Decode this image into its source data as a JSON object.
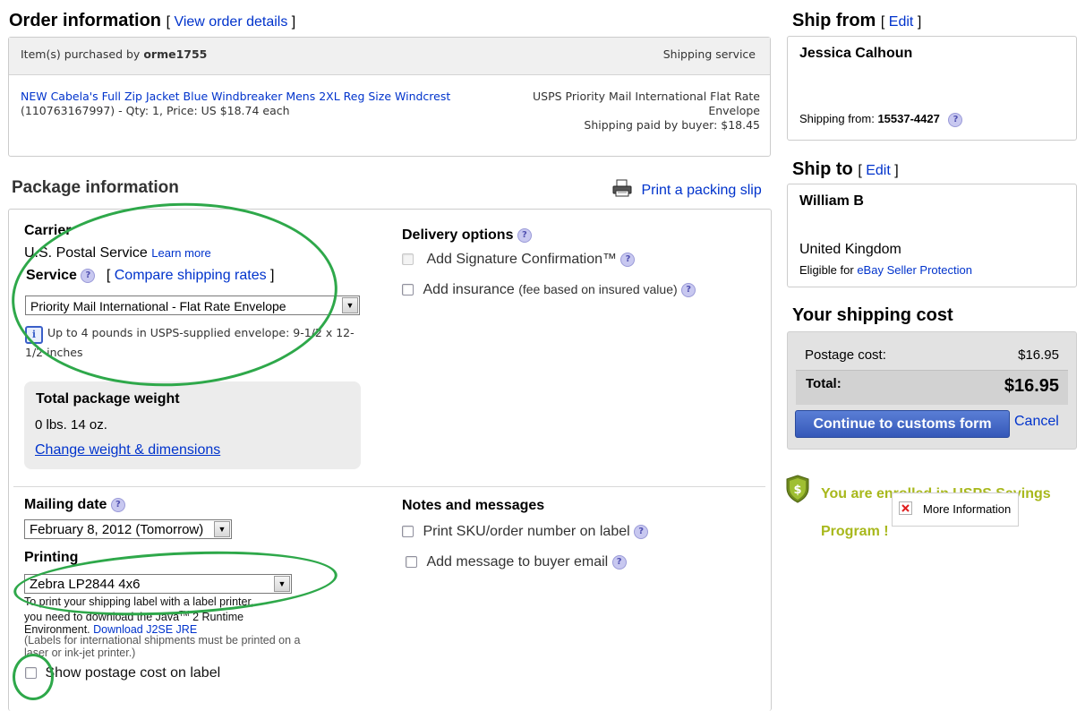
{
  "order": {
    "title": "Order information",
    "view_details_link": "View order details",
    "purchased_by_label": "Item(s) purchased by",
    "buyer": "orme1755",
    "shipping_service_header": "Shipping service",
    "item_title": "NEW Cabela's Full Zip Jacket Blue Windbreaker Mens 2XL Reg Size Windcrest",
    "item_details": "(110763167997) - Qty: 1, Price: US $18.74 each",
    "service_line1": "USPS Priority Mail International Flat Rate",
    "service_line2": "Envelope",
    "shipping_paid": "Shipping paid by buyer: $18.45"
  },
  "package": {
    "title": "Package information",
    "print_slip": "Print a packing slip",
    "carrier_label": "Carrier",
    "carrier_value": "U.S. Postal Service",
    "learn_more": "Learn more",
    "service_label": "Service",
    "compare_rates": "Compare shipping rates",
    "service_selected": "Priority Mail International - Flat Rate Envelope",
    "service_note": "Up to 4 pounds in USPS-supplied envelope: 9-1/2 x 12-1/2 inches",
    "delivery_options_label": "Delivery options",
    "signature_label": "Add Signature Confirmation™",
    "insurance_label": "Add insurance",
    "insurance_note": "(fee based on insured value)",
    "weight_title": "Total package weight",
    "weight_value": "0 lbs. 14 oz.",
    "change_weight": "Change weight & dimensions",
    "mailing_date_label": "Mailing date",
    "mailing_date_selected": "February 8, 2012 (Tomorrow)",
    "printing_label": "Printing",
    "printer_selected": "Zebra LP2844 4x6",
    "printer_note_1": "To print your shipping label with a label printer,",
    "printer_note_2": "you need to download the Java",
    "printer_note_tm": "TM",
    "printer_note_3": " 2 Runtime",
    "printer_note_4": "Environment.",
    "download_link": "Download J2SE JRE",
    "printer_note_5": "(Labels for international shipments must be printed on a",
    "printer_note_6": "laser or ink-jet printer.)",
    "show_postage_label": "Show postage cost on label",
    "notes_label": "Notes and messages",
    "print_sku_label": "Print SKU/order number on label",
    "add_message_label": "Add message to buyer email"
  },
  "ship_from": {
    "title": "Ship from",
    "edit": "Edit",
    "name": "Jessica Calhoun",
    "from_label": "Shipping from:",
    "zip": "15537-4427"
  },
  "ship_to": {
    "title": "Ship to",
    "edit": "Edit",
    "name": "William B",
    "country": "United Kingdom",
    "eligible_label": "Eligible for",
    "protection_link": "eBay Seller Protection"
  },
  "cost": {
    "title": "Your shipping cost",
    "postage_label": "Postage cost:",
    "postage_value": "$16.95",
    "total_label": "Total:",
    "total_value": "$16.95",
    "continue_button": "Continue to customs form",
    "cancel_link": "Cancel"
  },
  "savings": {
    "text_line1": "You are enrolled in USPS Savings",
    "text_line2": "Program !",
    "more_info": "More Information"
  },
  "colors": {
    "link": "#0033cc",
    "annotation_green": "#2ea84a",
    "savings_text": "#a8b81c",
    "button_blue": "#3f63c4"
  }
}
